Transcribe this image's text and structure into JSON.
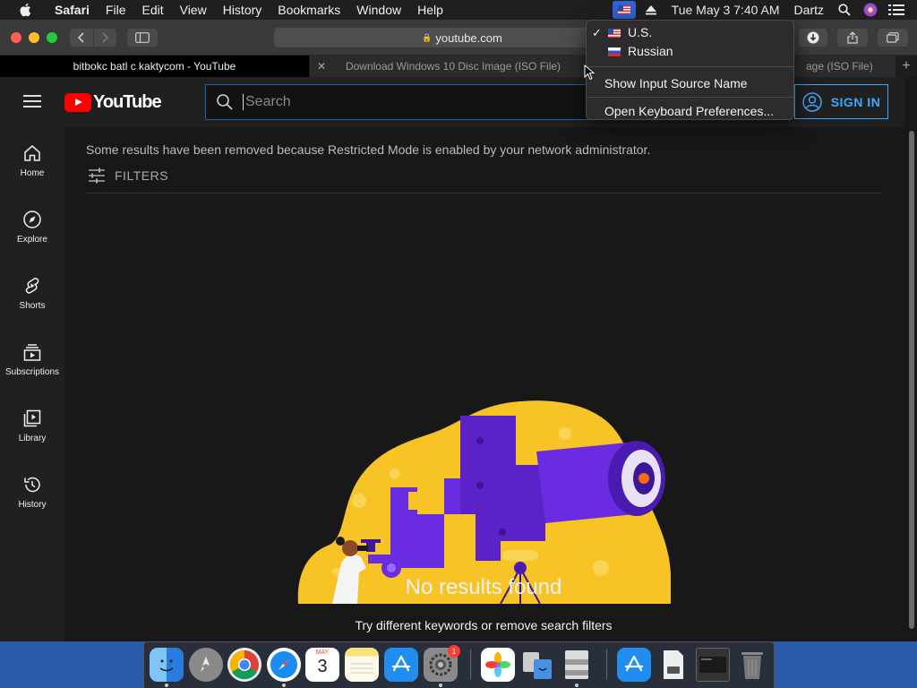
{
  "menubar": {
    "app": "Safari",
    "items": [
      "File",
      "Edit",
      "View",
      "History",
      "Bookmarks",
      "Window",
      "Help"
    ],
    "clock": "Tue May 3  7:40 AM",
    "user": "Dartz"
  },
  "safari": {
    "address": "youtube.com",
    "tabs": [
      {
        "title": "bitbokc batl c kaktycom - YouTube"
      },
      {
        "title": "Download Windows 10 Disc Image (ISO File)"
      },
      {
        "title": "age (ISO File)"
      }
    ]
  },
  "input_menu": {
    "sources": [
      {
        "label": "U.S.",
        "checked": "✓"
      },
      {
        "label": "Russian"
      }
    ],
    "actions": [
      "Show Input Source Name",
      "Open Keyboard Preferences..."
    ]
  },
  "youtube": {
    "logo_text": "YouTube",
    "search_placeholder": "Search",
    "signin_label": "SIGN IN",
    "sidebar": [
      {
        "label": "Home"
      },
      {
        "label": "Explore"
      },
      {
        "label": "Shorts"
      },
      {
        "label": "Subscriptions"
      },
      {
        "label": "Library"
      },
      {
        "label": "History"
      }
    ],
    "notice": "Some results have been removed because Restricted Mode is enabled by your network administrator.",
    "filters_label": "FILTERS",
    "empty_title": "No results found",
    "empty_subtitle": "Try different keywords or remove search filters"
  },
  "dock": {
    "calendar_month": "MAY",
    "calendar_day": "3",
    "settings_badge": "1"
  },
  "colors": {
    "youtube_red": "#ff0000",
    "link_blue": "#3ea6ff",
    "illustration_yellow": "#f7c325",
    "illustration_purple": "#6a2ce0",
    "desktop_blue": "#2a5aa8"
  }
}
